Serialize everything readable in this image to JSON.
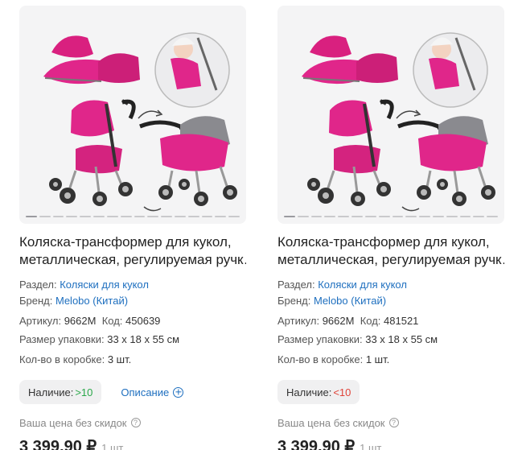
{
  "colors": {
    "link": "#1e6fbf",
    "in_stock": "#2aa84a",
    "low_stock": "#e0443a",
    "stroller_pink": "#e0268a"
  },
  "products": [
    {
      "title_line1": "Коляска-трансформер для кукол,",
      "title_line2": "металлическая, регулируемая ручк…",
      "section_label": "Раздел:",
      "section_value": "Коляски для кукол",
      "brand_label": "Бренд:",
      "brand_value": "Melobo (Китай)",
      "article_label": "Артикул:",
      "article_value": "9662M",
      "code_label": "Код:",
      "code_value": "450639",
      "pack_label": "Размер упаковки:",
      "pack_value": "33 x 18 x 55 см",
      "box_label": "Кол-во в коробке:",
      "box_value": "3 шт.",
      "stock_label": "Наличие:",
      "stock_value": ">10",
      "description_link": "Описание",
      "price_label": "Ваша цена без скидок",
      "price": "3 399,90 ₽",
      "price_unit": "1 шт."
    },
    {
      "title_line1": "Коляска-трансформер для кукол,",
      "title_line2": "металлическая, регулируемая ручк…",
      "section_label": "Раздел:",
      "section_value": "Коляски для кукол",
      "brand_label": "Бренд:",
      "brand_value": "Melobo (Китай)",
      "article_label": "Артикул:",
      "article_value": "9662M",
      "code_label": "Код:",
      "code_value": "481521",
      "pack_label": "Размер упаковки:",
      "pack_value": "33 x 18 x 55 см",
      "box_label": "Кол-во в коробке:",
      "box_value": "1 шт.",
      "stock_label": "Наличие:",
      "stock_value": "<10",
      "price_label": "Ваша цена без скидок",
      "price": "3 399,90 ₽",
      "price_unit": "1 шт."
    }
  ]
}
